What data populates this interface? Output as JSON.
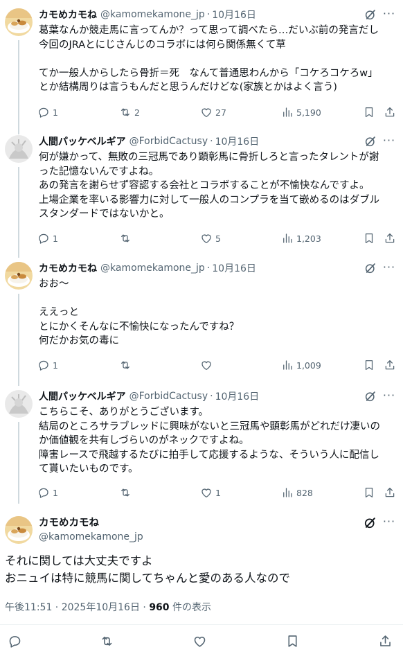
{
  "tweets": [
    {
      "name": "カモめカモね",
      "handle": "@kamomekamone_jp",
      "date": "10月16日",
      "text": "葛葉なんか競走馬に言ってんか？って思って調べたら…だいぶ前の発言だし\n今回のJRAとにじさんじのコラボには何ら関係無くて草\n\nてか一般人からしたら骨折＝死　なんて普通思わんから「コケろコケろw」\nとか結構周りは言うもんだと思うんだけどな(家族とかはよく言う)",
      "replies": "1",
      "reposts": "2",
      "likes": "27",
      "views": "5,190"
    },
    {
      "name": "人間パッケベルギア",
      "handle": "@ForbidCactusy",
      "date": "10月16日",
      "text": "何が嫌かって、無敗の三冠馬であり顕彰馬に骨折しろと言ったタレントが謝\nった記憶ないんですよね。\nあの発言を謝らせず容認する会社とコラボすることが不愉快なんですよ。\n上場企業を率いる影響力に対して一般人のコンプラを当て嵌めるのはダブル\nスタンダードではないかと。",
      "replies": "1",
      "reposts": "",
      "likes": "5",
      "views": "1,203"
    },
    {
      "name": "カモめカモね",
      "handle": "@kamomekamone_jp",
      "date": "10月16日",
      "text": "おお〜\n\nええっと\nとにかくそんなに不愉快になったんですね？\n何だかお気の毒に",
      "replies": "1",
      "reposts": "",
      "likes": "",
      "views": "1,009"
    },
    {
      "name": "人間パッケベルギア",
      "handle": "@ForbidCactusy",
      "date": "10月16日",
      "text": "こちらこそ、ありがとうございます。\n結局のところサラブレッドに興味がないと三冠馬や顕彰馬がどれだけ凄いの\nか価値観を共有しづらいのがネックですよね。\n障害レースで飛越するたびに拍手して応援するような、そういう人に配信し\nて貰いたいものです。",
      "replies": "1",
      "reposts": "",
      "likes": "1",
      "views": "828"
    }
  ],
  "main_tweet": {
    "name": "カモめカモね",
    "handle": "@kamomekamone_jp",
    "text": "それに関しては大丈夫ですよ\nおニュイは特に競馬に関してちゃんと愛のある人なので",
    "time": "午後11:51 · 2025年10月16日 · ",
    "views_count": "960",
    "views_label": " 件の表示"
  },
  "common": {
    "dot": "·",
    "more": "···"
  },
  "icons": [
    "reply-icon",
    "repost-icon",
    "like-icon",
    "views-icon",
    "bookmark-icon",
    "share-icon",
    "grok-icon",
    "more-icon"
  ],
  "colors": {
    "text": "#0f1419",
    "secondary": "#536471",
    "line": "#cfd9de"
  }
}
